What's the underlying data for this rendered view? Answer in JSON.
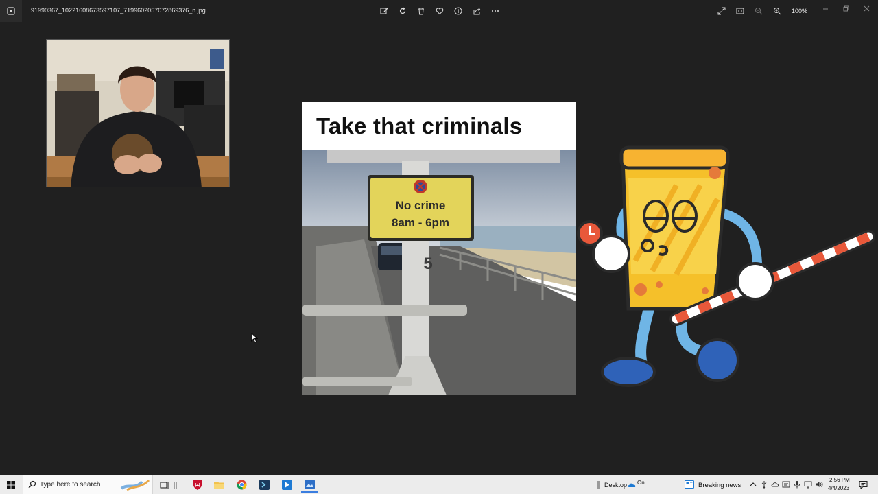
{
  "titlebar": {
    "filename": "91990367_10221608673597107_7199602057072869376_n.jpg",
    "tools": [
      "edit-icon",
      "rotate-icon",
      "delete-icon",
      "favorite-icon",
      "info-icon",
      "share-icon",
      "more-icon"
    ],
    "zoom_label": "100%"
  },
  "meme": {
    "title": "Take that criminals",
    "sign_line1": "No crime",
    "sign_line2": "8am - 6pm",
    "pole_number": "5"
  },
  "taskbar": {
    "search_placeholder": "Type here to search",
    "desktop_label": "Desktop",
    "onedrive_label": "On",
    "news_label": "Breaking news",
    "time": "2:56 PM",
    "date": "4/4/2023"
  },
  "colors": {
    "window_bg": "#202020",
    "taskbar_bg": "#ececec",
    "sign_yellow": "#e3d45a",
    "mascot_yellow": "#f5c02a",
    "mascot_blue": "#6fb5e6"
  }
}
